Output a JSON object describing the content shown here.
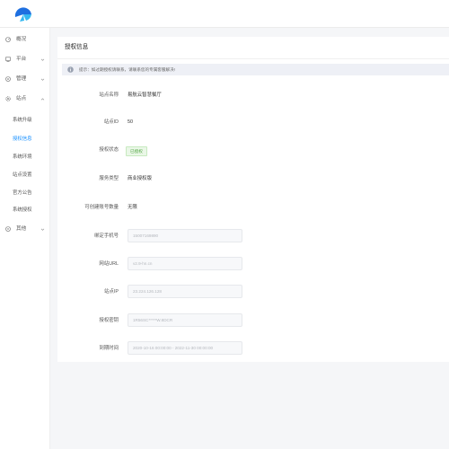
{
  "sidebar": {
    "items": [
      {
        "label": "概况",
        "icon": "dashboard-icon"
      },
      {
        "label": "平台",
        "icon": "monitor-icon",
        "arrow": "chevron-down-icon"
      },
      {
        "label": "管理",
        "icon": "admin-icon",
        "arrow": "chevron-down-icon"
      },
      {
        "label": "站点",
        "icon": "gear-icon",
        "arrow": "chevron-up-icon"
      },
      {
        "label": "其他",
        "icon": "settings-icon",
        "arrow": "chevron-down-icon"
      }
    ],
    "sub_items": [
      "系统升级",
      "授权信息",
      "系统环境",
      "站点设置",
      "官方公告",
      "系统授权"
    ],
    "active_sub": "授权信息"
  },
  "card": {
    "title": "授权信息",
    "notice": "提示：如过期授权请联系，请联系您的专属客服解决!"
  },
  "fields": {
    "site_name": {
      "label": "站点名称",
      "value": "易航云智慧餐厅"
    },
    "site_id": {
      "label": "站点ID",
      "value": "50"
    },
    "auth_status": {
      "label": "授权状态",
      "value": "已授权"
    },
    "service_type": {
      "label": "服务类型",
      "value": "商业授权版"
    },
    "account_count": {
      "label": "可创建账号数量",
      "value": "无限"
    },
    "phone": {
      "label": "绑定手机号",
      "value": "15007169890"
    },
    "site_url": {
      "label": "网站URL",
      "value": "v2.9-hn.cn"
    },
    "site_ip": {
      "label": "站点IP",
      "value": "23.224.126.128"
    },
    "auth_key": {
      "label": "授权密钥",
      "value": "1R56SC*****W.8DCR"
    },
    "expiry": {
      "label": "到期时间",
      "value": "2020-10-16 00:00:00 - 2022-11-30 00:00:00"
    }
  },
  "colors": {
    "accent": "#1890ff",
    "success": "#52a643",
    "logo_blue": "#1e6fe0",
    "logo_cyan": "#35b8f0"
  }
}
